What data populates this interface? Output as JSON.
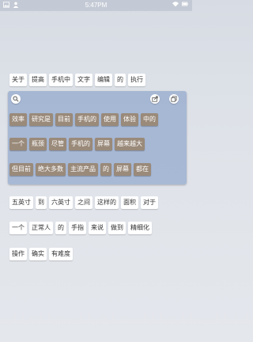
{
  "status_bar": {
    "time": "5:47PM",
    "left_icons": [
      "image-icon",
      "user-icon"
    ],
    "right_icons": [
      "wifi-icon",
      "battery-icon"
    ]
  },
  "rows": [
    [
      "关于",
      "提高",
      "手机中",
      "文字",
      "编辑",
      "的",
      "执行"
    ],
    [
      "效率",
      "研究是",
      "目前",
      "手机的",
      "使用",
      "体验",
      "中的"
    ],
    [
      "一个",
      "瓶颈",
      "尽管",
      "手机的",
      "屏幕",
      "越来越大"
    ],
    [
      "但目前",
      "绝大多数",
      "主流产品",
      "的",
      "屏幕",
      "都在"
    ],
    [
      "五英寸",
      "到",
      "六英寸",
      "之间",
      "这样的",
      "面积",
      "对于"
    ],
    [
      "一个",
      "正常人",
      "的",
      "手指",
      "来说",
      "做到",
      "精细化"
    ],
    [
      "操作",
      "确实",
      "有难度"
    ]
  ],
  "panel": {
    "controls": [
      "search-icon",
      "share-icon",
      "copy-icon"
    ]
  }
}
